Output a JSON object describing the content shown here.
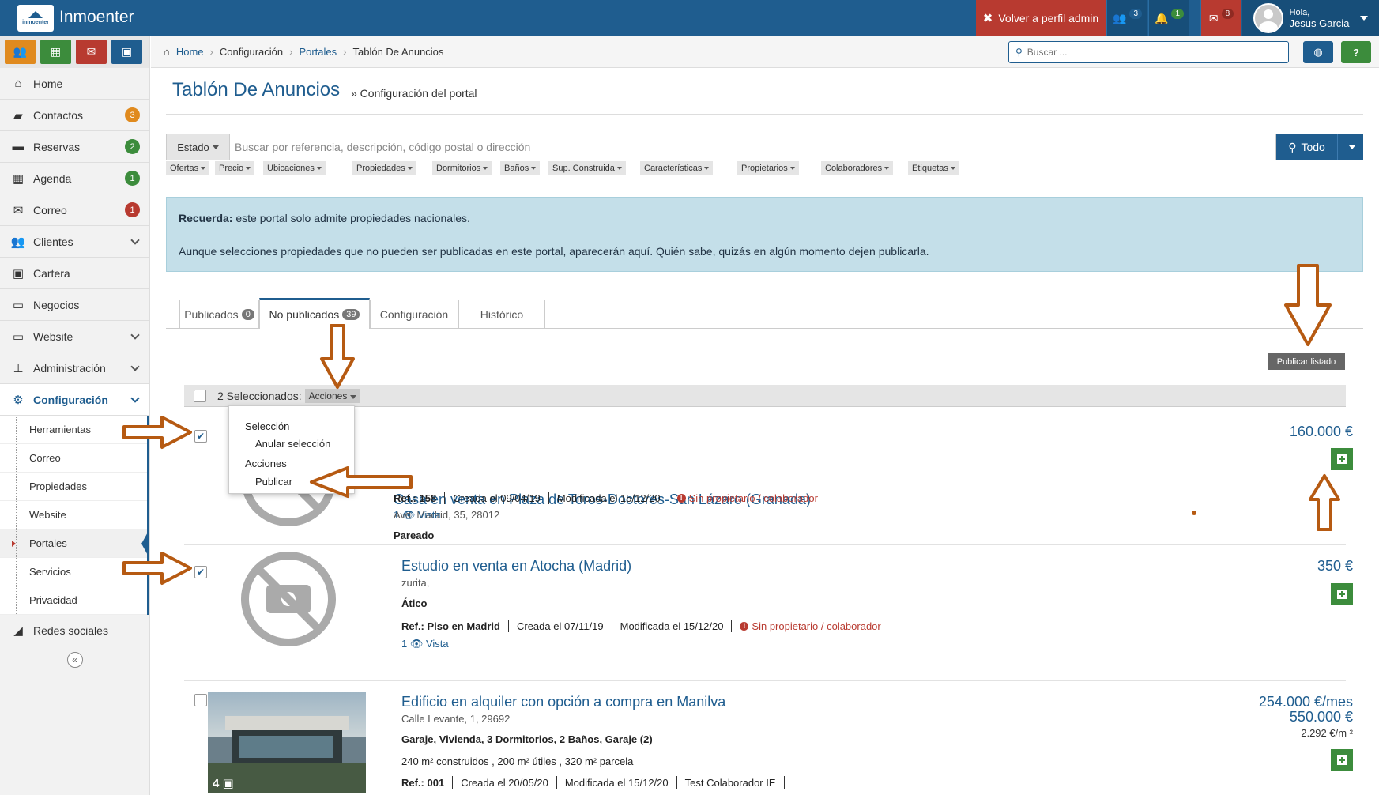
{
  "app": {
    "name": "Inmoenter",
    "logo_text": "inmoenter"
  },
  "topbar": {
    "volver": "Volver a perfil admin",
    "team_count": "3",
    "notif_count": "1",
    "mail_count": "8",
    "user_greeting": "Hola,",
    "user_name": "Jesus Garcia"
  },
  "sidebar": {
    "items": [
      {
        "label": "Home"
      },
      {
        "label": "Contactos",
        "badge": "3"
      },
      {
        "label": "Reservas",
        "badge": "2"
      },
      {
        "label": "Agenda",
        "badge": "1"
      },
      {
        "label": "Correo",
        "badge": "1"
      },
      {
        "label": "Clientes"
      },
      {
        "label": "Cartera"
      },
      {
        "label": "Negocios"
      },
      {
        "label": "Website"
      },
      {
        "label": "Administración"
      },
      {
        "label": "Configuración"
      }
    ],
    "sub": [
      "Herramientas",
      "Correo",
      "Propiedades",
      "Website",
      "Portales",
      "Servicios",
      "Privacidad"
    ],
    "redes": "Redes sociales",
    "collapse": "«"
  },
  "breadcrumb": [
    "Home",
    "Configuración",
    "Portales",
    "Tablón De Anuncios"
  ],
  "search": {
    "placeholder": "Buscar ..."
  },
  "header": {
    "help": "?"
  },
  "page": {
    "title": "Tablón De Anuncios",
    "subtitle": "» Configuración del portal"
  },
  "filters": {
    "estado": "Estado",
    "query_placeholder": "Buscar por referencia, descripción, código postal o dirección",
    "todo": "Todo",
    "chips": [
      "Ofertas",
      "Precio",
      "Ubicaciones",
      "Propiedades",
      "Dormitorios",
      "Baños",
      "Sup. Construida",
      "Características",
      "Propietarios",
      "Colaboradores",
      "Etiquetas"
    ]
  },
  "alert": {
    "bold": "Recuerda:",
    "line1": " este portal solo admite propiedades nacionales.",
    "line2": "Aunque selecciones propiedades que no pueden ser publicadas en este portal, aparecerán aquí. Quién sabe, quizás en algún momento dejen publicarla."
  },
  "tabs": [
    {
      "label": "Publicados",
      "count": "0"
    },
    {
      "label": "No publicados",
      "count": "39"
    },
    {
      "label": "Configuración"
    },
    {
      "label": "Histórico"
    }
  ],
  "publicar_listado": "Publicar listado",
  "selection": {
    "text": "2 Seleccionados:",
    "acciones": "Acciones"
  },
  "dropdown": {
    "h1": "Selección",
    "i1": "Anular selección",
    "h2": "Acciones",
    "i2": "Publicar"
  },
  "listings": [
    {
      "title": "Casa en venta en Plaza de Toros-Doctores-San Lázaro (Granada)",
      "address": "Avd. Madrid, 35, 28012",
      "type": "Pareado",
      "ref_label": "Ref.:",
      "ref": "158",
      "created": "Creada el 09/04/19",
      "modified": "Modificada el 15/12/20",
      "warning": "Sin propietario / colaborador",
      "vista": "1 👁 Vista",
      "price": "160.000 €"
    },
    {
      "title": "Estudio en venta en Atocha (Madrid)",
      "address": "zurita,",
      "type": "Ático",
      "ref_label": "Ref.:",
      "ref": "Piso en Madrid",
      "created": "Creada el 07/11/19",
      "modified": "Modificada el 15/12/20",
      "warning": "Sin propietario / colaborador",
      "vista": "1 👁 Vista",
      "price": "350 €"
    },
    {
      "title": "Edificio en alquiler con opción a compra en Manilva",
      "address": "Calle Levante, 1, 29692",
      "type": "Garaje, Vivienda, 3 Dormitorios, 2 Baños, Garaje (2)",
      "surface": "240 m² construidos , 200 m² útiles , 320 m² parcela",
      "ref_label": "Ref.:",
      "ref": "001",
      "created": "Creada el 20/05/20",
      "modified": "Modificada el 15/12/20",
      "colab": "Test Colaborador IE",
      "price": "254.000 €/mes",
      "price2": "550.000 €",
      "price3": "2.292 €/m ²",
      "photos": "4"
    }
  ],
  "colors": {
    "primary": "#1f5d8f",
    "danger": "#b83a30",
    "success": "#3c8c3c",
    "warning": "#e08a1e",
    "annotation": "#b65a12"
  }
}
